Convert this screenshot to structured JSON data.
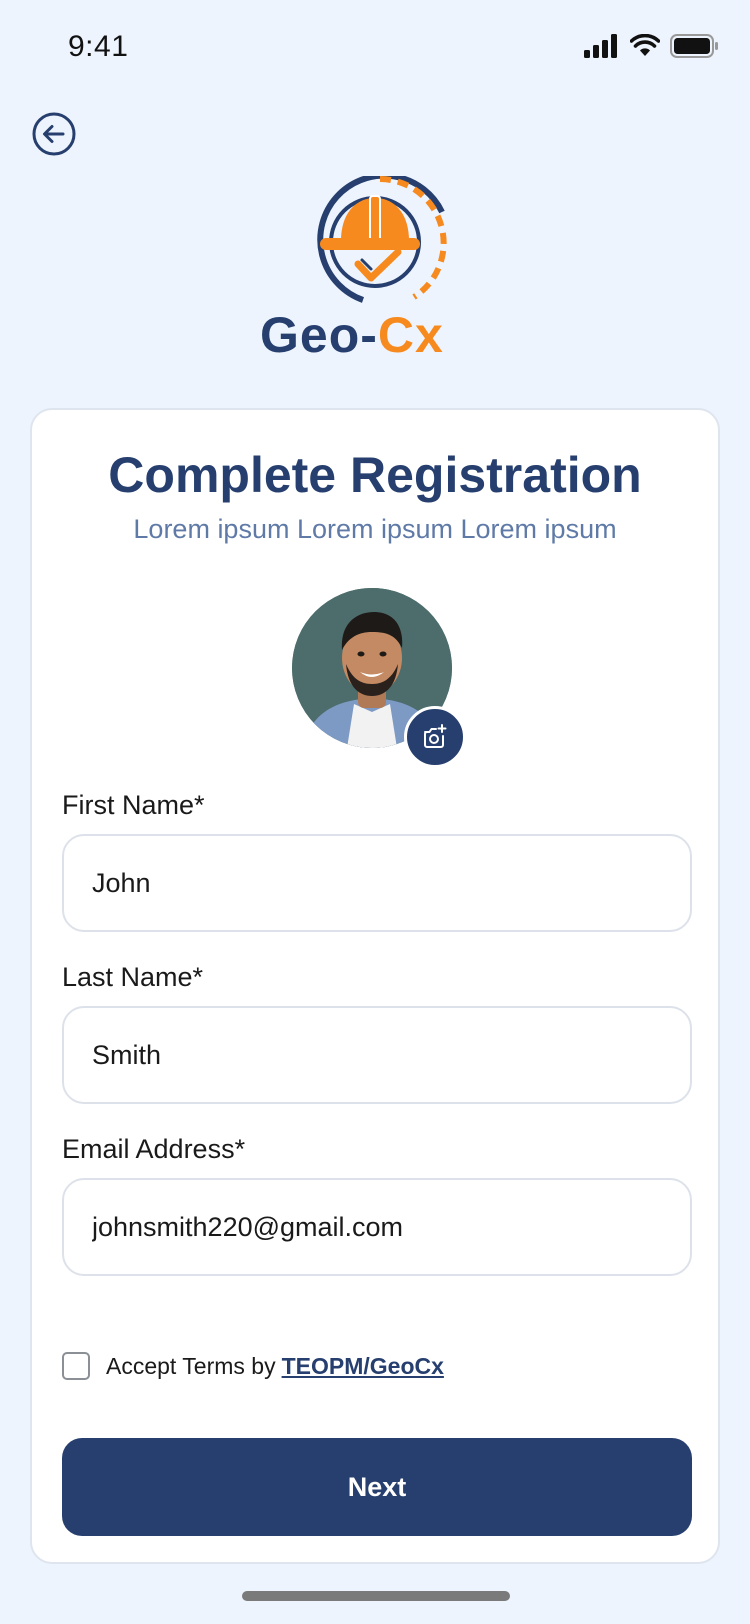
{
  "status_bar": {
    "time": "9:41",
    "icons": [
      "cellular-signal-icon",
      "wifi-icon",
      "battery-icon"
    ]
  },
  "header": {
    "back_icon": "arrow-left-circle-icon",
    "logo": {
      "text_part1": "Geo-",
      "text_part2": "Cx"
    }
  },
  "card": {
    "title": "Complete Registration",
    "subtitle": "Lorem ipsum Lorem ipsum Lorem ipsum",
    "avatar_action_icon": "camera-plus-icon",
    "fields": {
      "first_name": {
        "label": "First Name*",
        "value": "John"
      },
      "last_name": {
        "label": "Last Name*",
        "value": "Smith"
      },
      "email": {
        "label": "Email Address*",
        "value": "johnsmith220@gmail.com"
      }
    },
    "terms": {
      "checked": false,
      "text": "Accept Terms by",
      "link": "TEOPM/GeoCx"
    },
    "next_label": "Next"
  },
  "colors": {
    "background": "#eef4fd",
    "primary": "#263f6e",
    "accent": "#f68a1f",
    "subtitle": "#5f7aa7"
  }
}
